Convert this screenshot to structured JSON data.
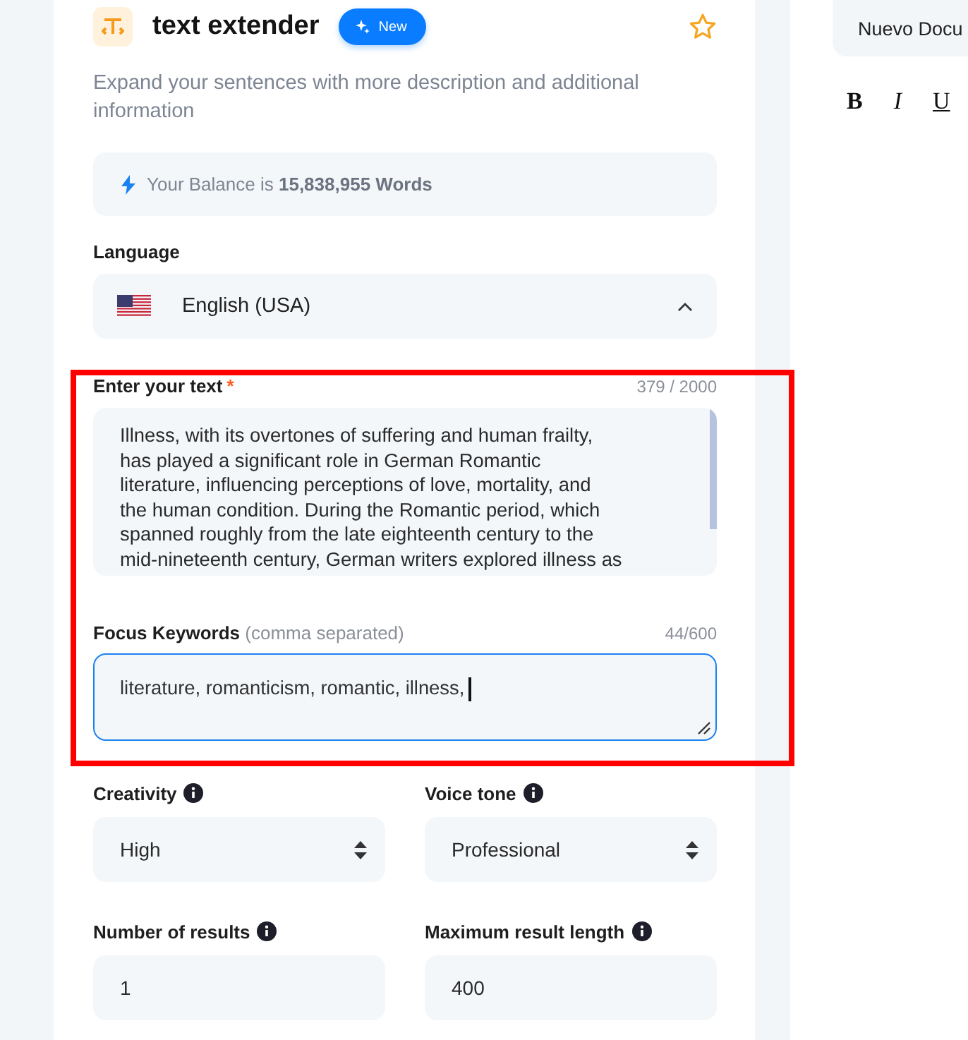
{
  "tool": {
    "title": "text extender",
    "badge": "New",
    "favorite": false,
    "description": "Expand your sentences with more description and additional information"
  },
  "balance": "Your Balance is **15,838,955 Words**",
  "language": {
    "label": "Language",
    "value": "English (USA)",
    "expanded": true
  },
  "text_input": {
    "label": "Enter your text",
    "required_mark": "*",
    "counter": "379 / 2000",
    "value": "Illness, with its overtones of suffering and human frailty,\nhas played a significant role in German Romantic\nliterature, influencing perceptions of love, mortality, and\nthe human condition. During the Romantic period, which\nspanned roughly from the late eighteenth century to the\nmid-nineteenth century, German writers explored illness as"
  },
  "keywords": {
    "label": "Focus Keywords",
    "hint": "(comma separated)",
    "counter": "44/600",
    "value": "literature, romanticism, romantic, illness,",
    "focused": true
  },
  "settings": [
    {
      "kind": "select",
      "label": "Creativity",
      "value": "High"
    },
    {
      "kind": "select",
      "label": "Voice tone",
      "value": "Professional"
    },
    {
      "kind": "input",
      "label": "Number of results",
      "value": "1"
    },
    {
      "kind": "input",
      "label": "Maximum result length",
      "value": "400"
    }
  ],
  "annotation": {
    "kind": "highlight"
  },
  "document": {
    "title": "Nuevo Docu",
    "format_buttons": [
      "B",
      "I",
      "U"
    ]
  }
}
